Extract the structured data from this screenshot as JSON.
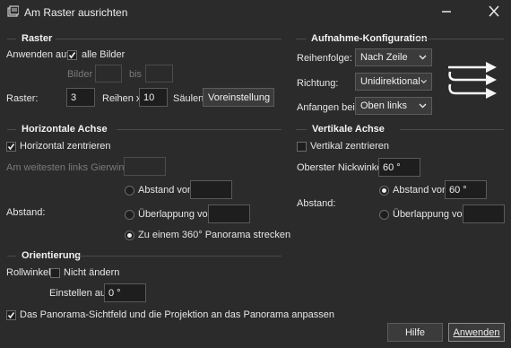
{
  "window": {
    "title": "Am Raster ausrichten",
    "icons": {
      "app": "dialog-icon",
      "minimize": "minimize-icon",
      "close": "close-icon"
    }
  },
  "raster": {
    "section_title": "Raster",
    "apply_label": "Anwenden auf:",
    "all_images_label": "alle Bilder",
    "all_images_checked": true,
    "images_label": "Bilder",
    "images_from": "",
    "to_label": "bis",
    "images_to": "",
    "grid_label": "Raster:",
    "rows_value": "3",
    "rows_label": "Reihen x",
    "cols_value": "10",
    "cols_label": "Säulen",
    "preset_label": "Voreinstellung"
  },
  "capture": {
    "section_title": "Aufnahme-Konfiguration",
    "order_label": "Reihenfolge:",
    "order_value": "Nach Zeile",
    "direction_label": "Richtung:",
    "direction_value": "Unidirektional",
    "start_label": "Anfangen bei:",
    "start_value": "Oben links",
    "diagram_icon": "capture-order-arrows-icon"
  },
  "horizontal": {
    "section_title": "Horizontale Achse",
    "center_label": "Horizontal zentrieren",
    "center_checked": true,
    "leftmost_label": "Am weitesten links Gierwinkel:",
    "leftmost_value": "",
    "spacing_label": "Abstand:",
    "distance_label": "Abstand von",
    "distance_value": "",
    "overlap_label": "Überlappung von",
    "overlap_value": "",
    "stretch_label": "Zu einem 360° Panorama strecken",
    "selected_option": "stretch"
  },
  "vertical": {
    "section_title": "Vertikale Achse",
    "center_label": "Vertikal zentrieren",
    "center_checked": false,
    "top_pitch_label": "Oberster Nickwinkel:",
    "top_pitch_value": "60 °",
    "spacing_label": "Abstand:",
    "distance_label": "Abstand von",
    "distance_value": "60 °",
    "overlap_label": "Überlappung von",
    "overlap_value": "",
    "selected_option": "distance"
  },
  "orientation": {
    "section_title": "Orientierung",
    "roll_label": "Rollwinkel",
    "no_change_label": "Nicht ändern",
    "no_change_checked": false,
    "set_to_label": "Einstellen auf",
    "set_to_value": "0 °"
  },
  "footer": {
    "adapt_label": "Das Panorama-Sichtfeld und die Projektion an das Panorama anpassen",
    "adapt_checked": true,
    "help_label": "Hilfe",
    "apply_label": "Anwenden"
  }
}
